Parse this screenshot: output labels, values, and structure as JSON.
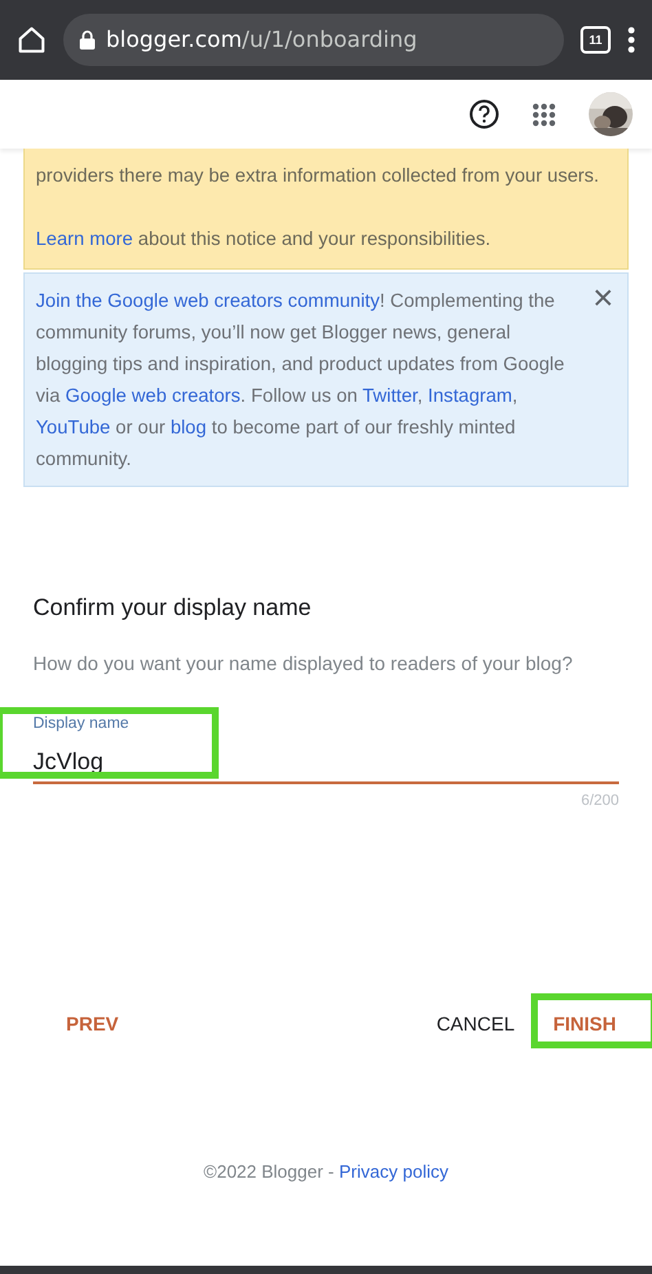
{
  "browser": {
    "url_host": "blogger.com",
    "url_path": "/u/1/onboarding",
    "tab_count": "11"
  },
  "notice": {
    "paragraph": [
      {
        "text": "providers there may be extra information collected from your users.",
        "kind": "text"
      }
    ],
    "footer": [
      {
        "text": "Learn more",
        "kind": "link"
      },
      {
        "text": " about this notice and your responsibilities.",
        "kind": "text"
      }
    ]
  },
  "community_banner": {
    "close": "×",
    "text": [
      {
        "text": "Join the Google web creators community",
        "kind": "link"
      },
      {
        "text": "! Complementing the community forums, you’ll now get Blogger news, general blogging tips and inspiration, and product updates from Google via ",
        "kind": "text"
      },
      {
        "text": "Google web creators",
        "kind": "link"
      },
      {
        "text": ". Follow us on ",
        "kind": "text"
      },
      {
        "text": "Twitter",
        "kind": "link"
      },
      {
        "text": ", ",
        "kind": "text"
      },
      {
        "text": "Instagram",
        "kind": "link"
      },
      {
        "text": ", ",
        "kind": "text"
      },
      {
        "text": "YouTube",
        "kind": "link"
      },
      {
        "text": " or our ",
        "kind": "text"
      },
      {
        "text": "blog",
        "kind": "link"
      },
      {
        "text": " to become part of our freshly minted community.",
        "kind": "text"
      }
    ]
  },
  "dialog": {
    "title": "Confirm your display name",
    "subtitle": "How do you want your name displayed to readers of your blog?",
    "field": {
      "label": "Display name",
      "value": "JcVlog",
      "counter": "6/200",
      "highlighted": true
    }
  },
  "buttons": [
    {
      "label": "PREV",
      "kind": "accent",
      "highlighted": false
    },
    {
      "label": "CANCEL",
      "kind": "plain",
      "highlighted": false
    },
    {
      "label": "FINISH",
      "kind": "accent",
      "highlighted": true
    }
  ],
  "footer": {
    "copyright": "©2022 Blogger - ",
    "link": "Privacy policy"
  }
}
